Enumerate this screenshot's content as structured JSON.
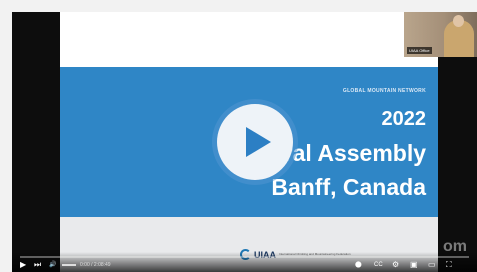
{
  "slide": {
    "network": "GLOBAL MOUNTAIN NETWORK",
    "year": "2022",
    "assembly": "General Assembly",
    "location": "Banff, Canada",
    "logo_text": "UIAA",
    "logo_sub": "International Climbing and Mountaineering Federation"
  },
  "webcam": {
    "name": "UIAA Office"
  },
  "watermark": "om",
  "player": {
    "time": "0:00 / 2:08:49",
    "play_label": "▶",
    "next_label": "⏭",
    "volume_label": "🔊",
    "autoplay_label": "⬤",
    "subtitles_label": "CC",
    "settings_label": "⚙",
    "miniplayer_label": "▣",
    "theater_label": "▭",
    "fullscreen_label": "⛶"
  }
}
